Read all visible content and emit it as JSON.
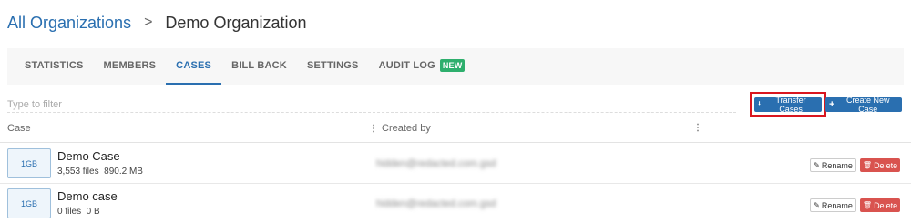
{
  "breadcrumb": {
    "parent": "All Organizations",
    "separator": ">",
    "current": "Demo Organization"
  },
  "tabs": [
    {
      "label": "STATISTICS",
      "active": false
    },
    {
      "label": "MEMBERS",
      "active": false
    },
    {
      "label": "CASES",
      "active": true
    },
    {
      "label": "BILL BACK",
      "active": false
    },
    {
      "label": "SETTINGS",
      "active": false
    },
    {
      "label": "AUDIT LOG",
      "active": false,
      "badge": "NEW"
    }
  ],
  "filter": {
    "placeholder": "Type to filter",
    "value": ""
  },
  "actions": {
    "transfer_label": "Transfer Cases",
    "transfer_icon": "download-icon",
    "create_label": "Create New Case",
    "create_icon": "plus-icon",
    "highlight_color": "#d9161f"
  },
  "table": {
    "columns": [
      "Case",
      "Created by",
      ""
    ],
    "rows": [
      {
        "size": "1GB",
        "name": "Demo Case",
        "meta": "3,553 files  890.2 MB",
        "creator": "hidden@redacted.com.gsd",
        "rename_label": "Rename",
        "delete_label": "Delete"
      },
      {
        "size": "1GB",
        "name": "Demo case",
        "meta": "0 files  0 B",
        "creator": "hidden@redacted.com.gsd",
        "rename_label": "Rename",
        "delete_label": "Delete"
      }
    ]
  },
  "colors": {
    "accent": "#2a6fb0",
    "danger": "#d9534f",
    "badge": "#2eaf6d"
  }
}
